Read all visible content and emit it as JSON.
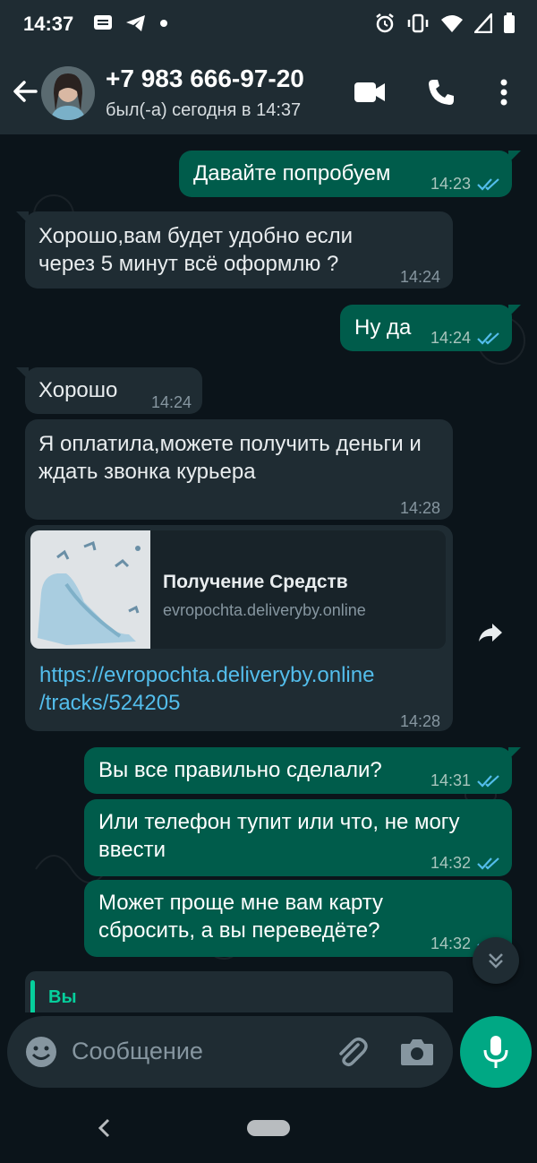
{
  "status_bar": {
    "time": "14:37",
    "left_icons": [
      "message-icon",
      "telegram-icon",
      "dot-icon"
    ],
    "right_icons": [
      "alarm-icon",
      "vibrate-icon",
      "wifi-icon",
      "signal-icon",
      "battery-icon"
    ]
  },
  "header": {
    "contact_name": "+7 983 666-97-20",
    "status": "был(-а) сегодня в 14:37",
    "actions": [
      "video-call-icon",
      "phone-icon",
      "more-vert-icon"
    ]
  },
  "messages": [
    {
      "direction": "out",
      "text": "Давайте попробуем",
      "time": "14:23",
      "read": true
    },
    {
      "direction": "in",
      "text": "Хорошо,вам будет удобно если через 5 минут всё оформлю ?",
      "time": "14:24"
    },
    {
      "direction": "out",
      "text": "Ну да",
      "time": "14:24",
      "read": true
    },
    {
      "direction": "in",
      "text": "Хорошо",
      "time": "14:24"
    },
    {
      "direction": "in",
      "text": "Я оплатила,можете получить деньги и ждать звонка курьера",
      "time": "14:28"
    },
    {
      "direction": "in",
      "type": "link",
      "link_title": "Получение Средств",
      "link_domain": "evropochta.deliveryby.online",
      "url_line1": "https://evropochta.deliveryby.online",
      "url_line2": "/tracks/524205",
      "time": "14:28"
    },
    {
      "direction": "out",
      "text": "Вы все правильно сделали?",
      "time": "14:31",
      "read": true
    },
    {
      "direction": "out",
      "text": "Или телефон тупит или что, не могу ввести",
      "time": "14:32",
      "read": true
    },
    {
      "direction": "out",
      "text": "Может проще мне вам карту сбросить, а вы переведёте?",
      "time": "14:32",
      "read": true
    }
  ],
  "reply_preview": {
    "name": "Вы"
  },
  "input": {
    "placeholder": "Сообщение"
  },
  "colors": {
    "outgoing": "#005c4b",
    "incoming": "#1f2c33",
    "accent": "#00a884",
    "link": "#53bdeb",
    "read_ticks": "#53bdeb"
  }
}
